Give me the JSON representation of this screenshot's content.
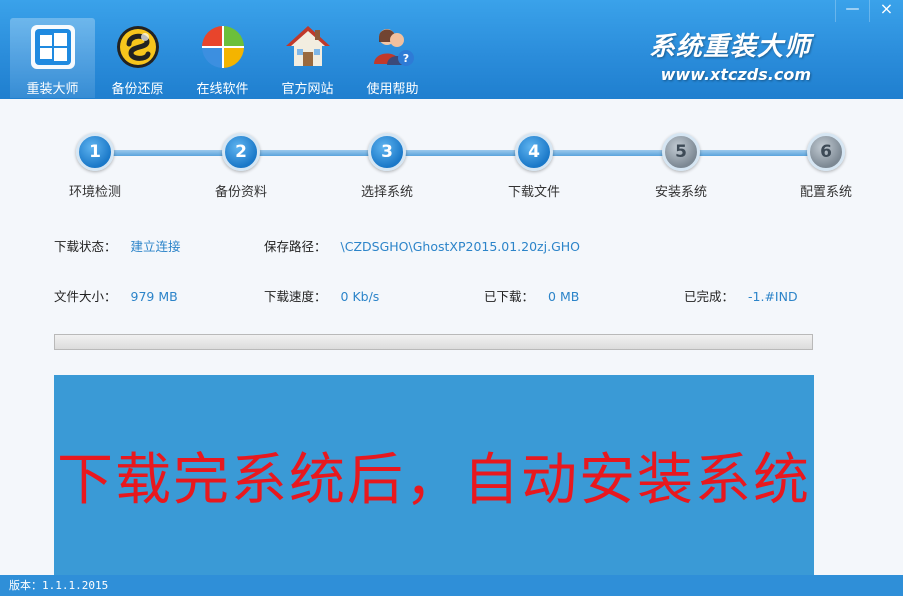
{
  "window": {
    "minimize_label": "—",
    "close_label": "×"
  },
  "nav": {
    "items": [
      {
        "label": "重装大师",
        "icon": "windows-logo-icon",
        "active": true
      },
      {
        "label": "备份还原",
        "icon": "backup-restore-icon",
        "active": false
      },
      {
        "label": "在线软件",
        "icon": "online-software-icon",
        "active": false
      },
      {
        "label": "官方网站",
        "icon": "home-website-icon",
        "active": false
      },
      {
        "label": "使用帮助",
        "icon": "help-users-icon",
        "active": false
      }
    ]
  },
  "brand": {
    "title": "系统重装大师",
    "url": "www.xtczds.com"
  },
  "steps": [
    {
      "number": "1",
      "label": "环境检测",
      "state": "done"
    },
    {
      "number": "2",
      "label": "备份资料",
      "state": "done"
    },
    {
      "number": "3",
      "label": "选择系统",
      "state": "done"
    },
    {
      "number": "4",
      "label": "下载文件",
      "state": "done"
    },
    {
      "number": "5",
      "label": "安装系统",
      "state": "todo"
    },
    {
      "number": "6",
      "label": "配置系统",
      "state": "todo"
    }
  ],
  "download": {
    "status_label": "下载状态：",
    "status_value": "建立连接",
    "path_label": "保存路径：",
    "path_value": "\\CZDSGHO\\GhostXP2015.01.20zj.GHO",
    "size_label": "文件大小：",
    "size_value": "979 MB",
    "speed_label": "下载速度：",
    "speed_value": "0 Kb/s",
    "downloaded_label": "已下载：",
    "downloaded_value": "0 MB",
    "completed_label": "已完成：",
    "completed_value": "-1.#IND",
    "progress_fraction": 0
  },
  "banner": {
    "text": "下载完系统后，自动安装系统"
  },
  "footer": {
    "version": "版本：1.1.1.2015"
  },
  "colors": {
    "header_blue": "#2b8ddb",
    "accent_value": "#2c84c9",
    "banner_bg": "#3a9ad6",
    "banner_text": "#e8181e"
  }
}
